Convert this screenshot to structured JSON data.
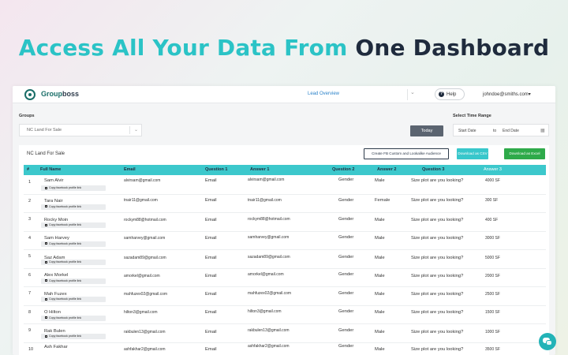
{
  "headline": {
    "part1": "Access All Your Data From",
    "part2": "One Dashboard"
  },
  "colors": {
    "accent_teal": "#2bc3c6",
    "header_teal": "#3cc8cc",
    "dark": "#1f2b3d",
    "excel_green": "#2eaa4a",
    "brand_green": "#1a6e68"
  },
  "topbar": {
    "brand_part1": "Group",
    "brand_part2": "boss",
    "page_title": "Lead Overview",
    "help_label": "Help",
    "user_email": "johndoe@smiths.com",
    "user_chevron": "▾"
  },
  "filters": {
    "groups_label": "Groups",
    "group_selected": "NC Land For Sale",
    "today_label": "Today",
    "time_range_label": "Select Time Range",
    "start_date_placeholder": "Start Date",
    "to_label": "to",
    "end_date_placeholder": "End Date"
  },
  "panel": {
    "group_name": "NC Land For Sale",
    "create_audience_label": "Create FB Custom and Lookalike Audience",
    "csv_label": "Download as CSV",
    "excel_label": "Download as Excel"
  },
  "table": {
    "headers": [
      "#",
      "Full Name",
      "Email",
      "Question 1",
      "Answer 1",
      "Question 2",
      "Answer 2",
      "Question 3",
      "Answer 3"
    ],
    "copy_label": "Copy facebook profile link",
    "rows": [
      {
        "num": "1",
        "name": "Sam Alvir",
        "email": "alvirsam@gmail.com",
        "q1": "Email",
        "a1": "alvirsam@gmail.com",
        "q2": "Gender",
        "a2": "Male",
        "q3": "Size plot are you looking?",
        "a3": "4000  SF"
      },
      {
        "num": "2",
        "name": "Tara Nair",
        "email": "tnair11@gmail.com",
        "q1": "Email",
        "a1": "tnair11@gmail.com",
        "q2": "Gender",
        "a2": "Female",
        "q3": "Size plot are you looking?",
        "a3": "300  SF"
      },
      {
        "num": "3",
        "name": "Rocky Moin",
        "email": "rockym88@hotmail.com",
        "q1": "Email",
        "a1": "rockym88@hotmail.com",
        "q2": "Gender",
        "a2": "Male",
        "q3": "Size plot are you looking?",
        "a3": "400  SF"
      },
      {
        "num": "4",
        "name": "Sam Harvey",
        "email": "samharvey@gmail.com",
        "q1": "Email",
        "a1": "samharvey@gmail.com",
        "q2": "Gender",
        "a2": "Male",
        "q3": "Size plot are you looking?",
        "a3": "3000  SF"
      },
      {
        "num": "5",
        "name": "Saz Adam",
        "email": "sazadam89@gmail.com",
        "q1": "Email",
        "a1": "sazadam89@gmail.com",
        "q2": "Gender",
        "a2": "Male",
        "q3": "Size plot are you looking?",
        "a3": "5000  SF"
      },
      {
        "num": "6",
        "name": "Alex Morkel",
        "email": "amorkel@gmail.com",
        "q1": "Email",
        "a1": "amorkel@gmail.com",
        "q2": "Gender",
        "a2": "Male",
        "q3": "Size plot are you looking?",
        "a3": "2000  SF"
      },
      {
        "num": "7",
        "name": "Mah Fuzex",
        "email": "mahfuzex02@gmail.com",
        "q1": "Email",
        "a1": "mahfuzex02@gmail.com",
        "q2": "Gender",
        "a2": "Male",
        "q3": "Size plot are you looking?",
        "a3": "2500  SF"
      },
      {
        "num": "8",
        "name": "O Hilton",
        "email": "hilton3@gmail.com",
        "q1": "Email",
        "a1": "hilton3@gmail.com",
        "q2": "Gender",
        "a2": "Male",
        "q3": "Size plot are you looking?",
        "a3": "1500  SF"
      },
      {
        "num": "9",
        "name": "Rak Bulen",
        "email": "rakbulen13@gmail.com",
        "q1": "Email",
        "a1": "rakbulen13@gmail.com",
        "q2": "Gender",
        "a2": "Male",
        "q3": "Size plot are you looking?",
        "a3": "1000  SF"
      },
      {
        "num": "10",
        "name": "Ash Fakhar",
        "email": "ashfakhar2@gmail.com",
        "q1": "Email",
        "a1": "ashfakhar2@gmail.com",
        "q2": "Gender",
        "a2": "Male",
        "q3": "Size plot are you looking?",
        "a3": "3500  SF"
      }
    ]
  }
}
